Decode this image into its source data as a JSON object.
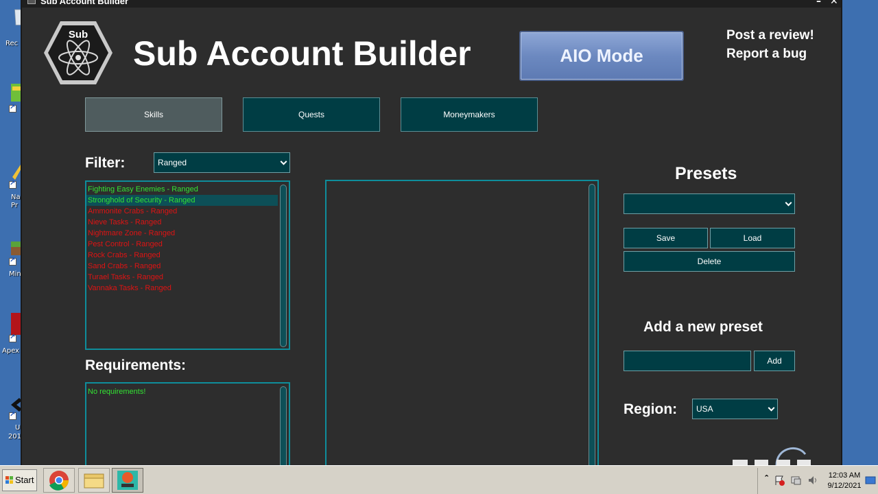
{
  "window": {
    "title": "Sub Account Builder",
    "minimize_label": "–",
    "close_label": "✕"
  },
  "header": {
    "logo_text": "Sub",
    "title": "Sub Account Builder",
    "aio_mode_label": "AIO Mode",
    "post_review_label": "Post a review!",
    "report_bug_label": "Report a bug"
  },
  "tabs": [
    {
      "label": "Skills",
      "active": true
    },
    {
      "label": "Quests",
      "active": false
    },
    {
      "label": "Moneymakers",
      "active": false
    }
  ],
  "filter": {
    "label": "Filter:",
    "selected": "Ranged"
  },
  "activities": [
    {
      "label": "Fighting Easy Enemies - Ranged",
      "status": "ok",
      "selected": false
    },
    {
      "label": "Stronghold of Security - Ranged",
      "status": "ok",
      "selected": true
    },
    {
      "label": "Ammonite Crabs - Ranged",
      "status": "bad",
      "selected": false
    },
    {
      "label": "Nieve Tasks - Ranged",
      "status": "bad",
      "selected": false
    },
    {
      "label": "Nightmare Zone - Ranged",
      "status": "bad",
      "selected": false
    },
    {
      "label": "Pest Control - Ranged",
      "status": "bad",
      "selected": false
    },
    {
      "label": "Rock Crabs - Ranged",
      "status": "bad",
      "selected": false
    },
    {
      "label": "Sand Crabs - Ranged",
      "status": "bad",
      "selected": false
    },
    {
      "label": "Turael Tasks - Ranged",
      "status": "bad",
      "selected": false
    },
    {
      "label": "Vannaka Tasks - Ranged",
      "status": "bad",
      "selected": false
    }
  ],
  "requirements": {
    "label": "Requirements:",
    "text": "No requirements!"
  },
  "presets": {
    "title": "Presets",
    "selected": "",
    "save_label": "Save",
    "load_label": "Load",
    "delete_label": "Delete"
  },
  "new_preset": {
    "title": "Add a new preset",
    "value": "",
    "add_label": "Add"
  },
  "region": {
    "label": "Region:",
    "selected": "USA"
  },
  "colors": {
    "window_bg": "#2d2d2d",
    "control_bg": "#003d44",
    "active_tab": "#4f5c5e",
    "list_border": "#0e8e9c",
    "available": "#33e433",
    "unavailable": "#e01313"
  },
  "desktop": {
    "icons": [
      {
        "label": "Rec",
        "icon": "recycle-bin-icon"
      },
      {
        "label": "",
        "icon": "shortcut-icon"
      },
      {
        "label": "Na",
        "sublabel": "Pr",
        "icon": "note-icon"
      },
      {
        "label": "Min",
        "icon": "minecraft-icon"
      },
      {
        "label": "Apex",
        "icon": "apex-icon"
      },
      {
        "label": "U",
        "sublabel": "201",
        "icon": "unity-icon"
      }
    ]
  },
  "taskbar": {
    "start_label": "Start",
    "time": "12:03 AM",
    "date": "9/12/2021"
  }
}
